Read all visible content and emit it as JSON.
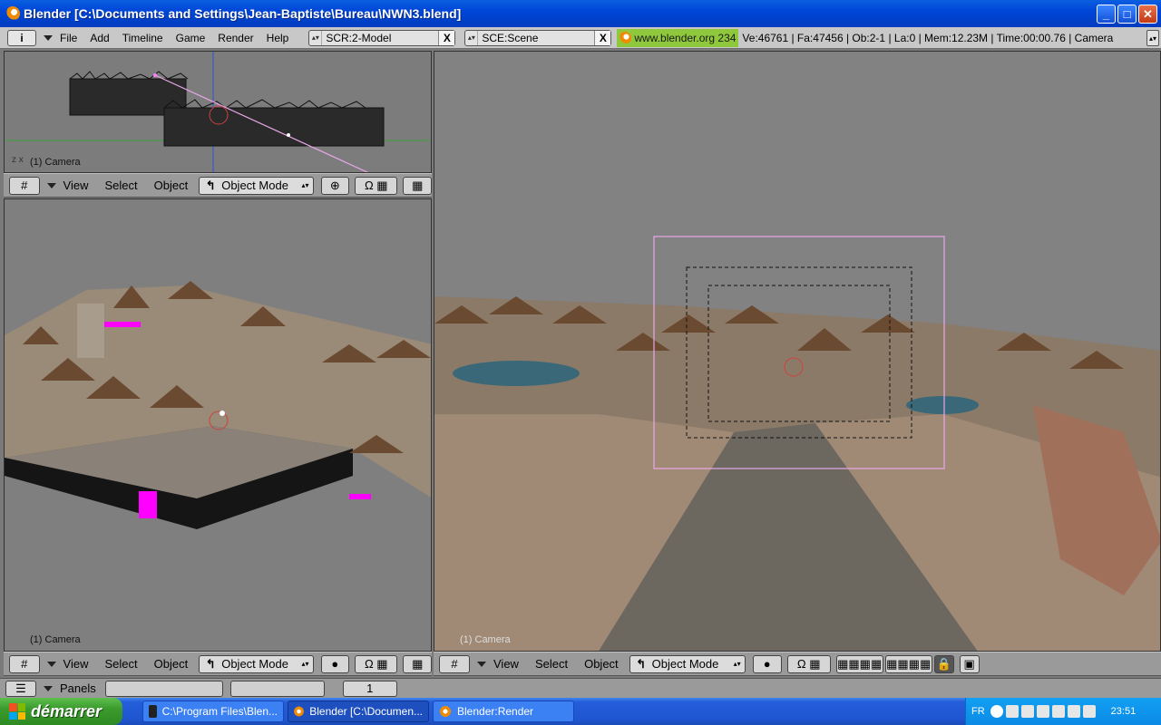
{
  "window": {
    "title": "Blender [C:\\Documents and Settings\\Jean-Baptiste\\Bureau\\NWN3.blend]",
    "controls": {
      "minimize": "_",
      "maximize": "□",
      "close": "✕"
    }
  },
  "menubar": {
    "info_icon": "i",
    "items": [
      "File",
      "Add",
      "Timeline",
      "Game",
      "Render",
      "Help"
    ],
    "screen": {
      "value": "SCR:2-Model",
      "clear": "X"
    },
    "scene": {
      "value": "SCE:Scene",
      "clear": "X"
    },
    "website": "www.blender.org 234",
    "stats": "Ve:46761 | Fa:47456 | Ob:2-1 | La:0 | Mem:12.23M | Time:00:00.76 | Camera"
  },
  "viewports": {
    "top": {
      "label": "(1) Camera"
    },
    "left": {
      "label": "(1) Camera"
    },
    "right": {
      "label": "(1) Camera"
    }
  },
  "viewport_header": {
    "menus": [
      "View",
      "Select",
      "Object"
    ],
    "mode": "Object Mode"
  },
  "buttons_header": {
    "label": "Panels",
    "frame": "1"
  },
  "taskbar": {
    "start_label": "démarrer",
    "tasks": [
      {
        "label": "C:\\Program Files\\Blen..."
      },
      {
        "label": "Blender [C:\\Documen..."
      },
      {
        "label": "Blender:Render"
      }
    ],
    "language": "FR",
    "clock": "23:51"
  },
  "colors": {
    "title_bar": "#0046d8",
    "blender_header": "#9a9a9a",
    "menu_bg": "#c8c8c8",
    "url_bg": "#8fc83c",
    "camera_frame": "#e8a8e8",
    "start_green": "#3a9b2d",
    "taskbar_blue": "#245edb"
  },
  "icons": {
    "blender_logo": "blender-logo-icon",
    "grid": "grid-icon",
    "draw_type": "solid-sphere-icon",
    "magnet": "magnet-icon",
    "layers": "layers-icon",
    "lock": "lock-icon",
    "render": "render-icon"
  }
}
